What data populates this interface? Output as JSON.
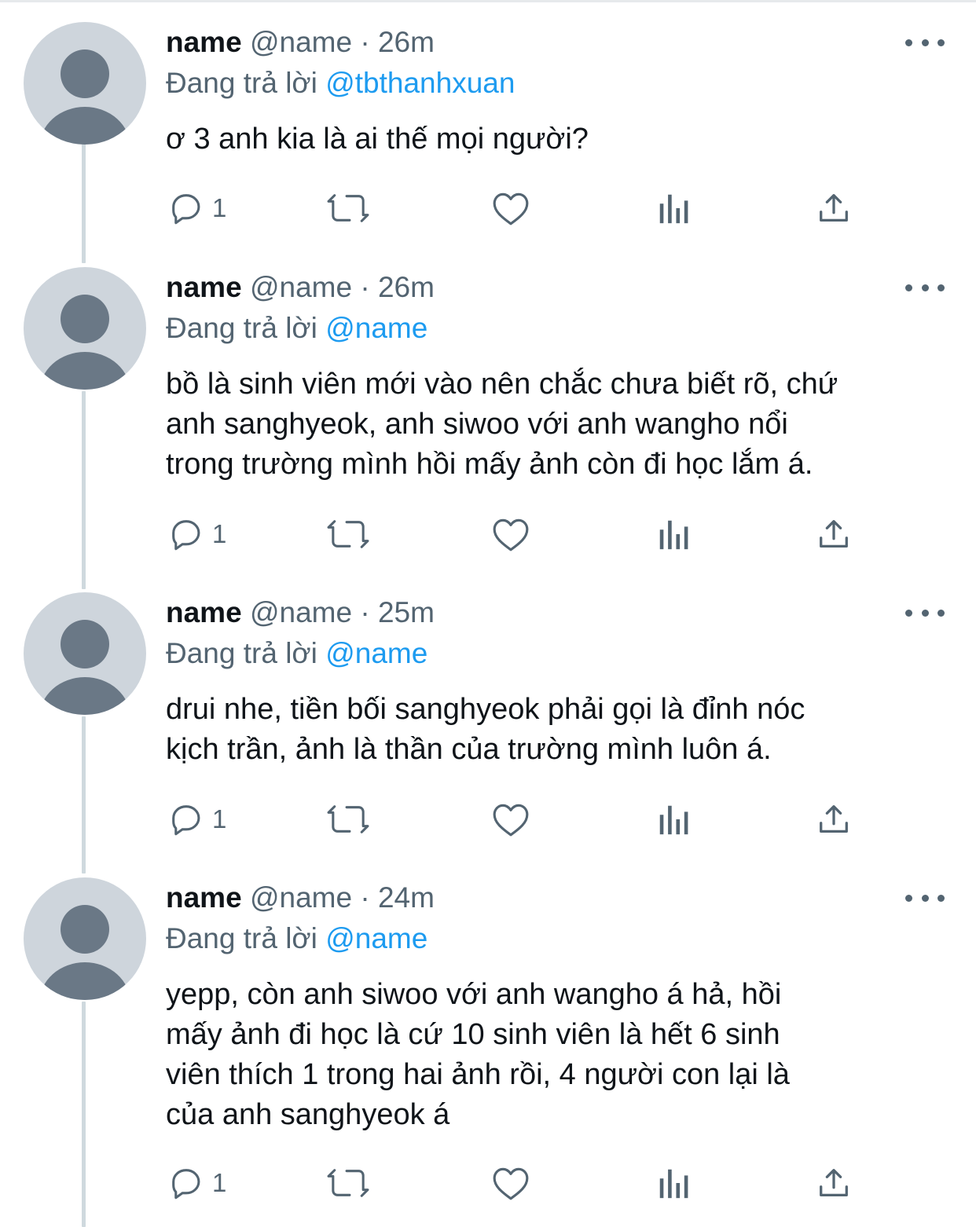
{
  "tweets": [
    {
      "name": "name",
      "handle": "@name",
      "separator": "·",
      "time": "26m",
      "reply_prefix": "Đang trả lời",
      "reply_to": "@tbthanhxuan",
      "lines": [
        "ơ 3 anh kia là ai thế mọi người?"
      ],
      "reply_count": "1"
    },
    {
      "name": "name",
      "handle": "@name",
      "separator": "·",
      "time": "26m",
      "reply_prefix": "Đang trả lời",
      "reply_to": "@name",
      "lines": [
        "bồ là sinh viên mới vào nên chắc chưa biết rõ, chứ",
        "anh sanghyeok, anh siwoo với anh wangho nổi",
        "trong trường mình hồi mấy ảnh còn đi học lắm á."
      ],
      "reply_count": "1"
    },
    {
      "name": "name",
      "handle": "@name",
      "separator": "·",
      "time": "25m",
      "reply_prefix": "Đang trả lời",
      "reply_to": "@name",
      "lines": [
        "drui nhe, tiền bối sanghyeok phải gọi là đỉnh nóc",
        "kịch trần, ảnh là thần của trường mình luôn á."
      ],
      "reply_count": "1"
    },
    {
      "name": "name",
      "handle": "@name",
      "separator": "·",
      "time": "24m",
      "reply_prefix": "Đang trả lời",
      "reply_to": "@name",
      "lines": [
        "yepp, còn anh siwoo với anh wangho á hả, hồi",
        "mấy ảnh đi học là cứ 10 sinh viên là hết 6 sinh",
        "viên thích 1 trong hai ảnh rồi, 4 người con lại là",
        "của anh sanghyeok á"
      ],
      "reply_count": "1"
    }
  ],
  "icons": {
    "reply": "reply-bubble-icon",
    "retweet": "retweet-icon",
    "like": "heart-icon",
    "views": "analytics-icon",
    "share": "share-icon",
    "more": "more-dots-icon",
    "avatar": "default-avatar-icon"
  },
  "colors": {
    "text": "#0f1419",
    "muted": "#536471",
    "link": "#1d9bf0",
    "thread_line": "#cfd9de",
    "avatar_bg": "#ced5dc",
    "avatar_fg": "#6a7886"
  }
}
